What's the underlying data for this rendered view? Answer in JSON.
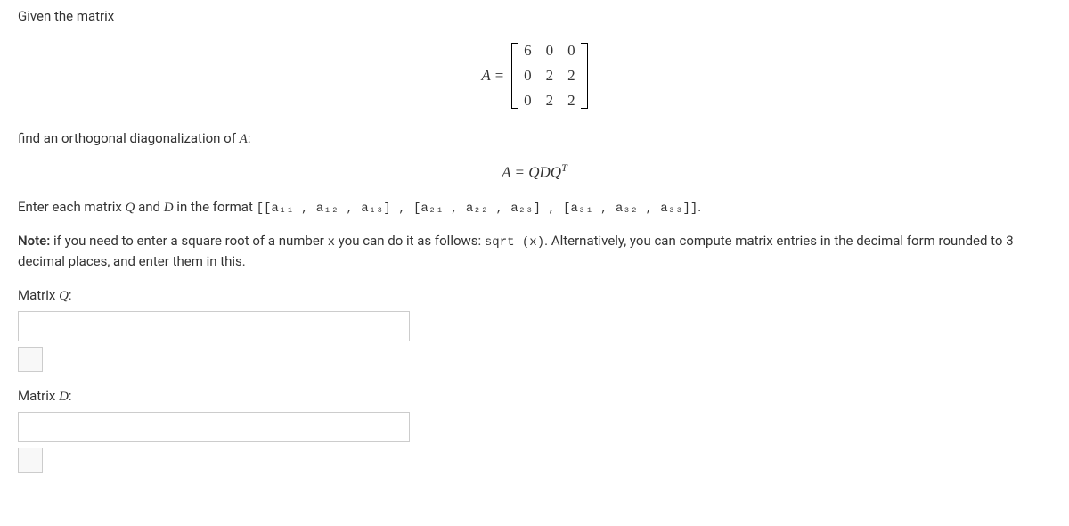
{
  "problem": {
    "intro": "Given the matrix",
    "matrix_label": "A =",
    "matrix": [
      [
        "6",
        "0",
        "0"
      ],
      [
        "0",
        "2",
        "2"
      ],
      [
        "0",
        "2",
        "2"
      ]
    ],
    "find_text_prefix": "find an orthogonal diagonalization of ",
    "find_text_symbol": "A",
    "find_text_suffix": ":",
    "diag_eq": "A = QDQ",
    "diag_eq_sup": "T",
    "enter_prefix": "Enter each matrix ",
    "enter_q": "Q",
    "enter_and": " and ",
    "enter_d": "D",
    "enter_mid": " in the format ",
    "format_string": "[[a₁₁ , a₁₂ , a₁₃] , [a₂₁ , a₂₂ , a₂₃] , [a₃₁ , a₃₂ , a₃₃]]",
    "enter_suffix": ".",
    "note_label": "Note:",
    "note_prefix": " if you need to enter a square root of a number ",
    "note_var": "x",
    "note_mid1": " you can do it as follows: ",
    "note_sqrt": "sqrt (x)",
    "note_mid2": ". Alternatively, you can compute matrix entries in the decimal form rounded to 3 decimal places, and enter them in this.",
    "matrix_q_label_prefix": "Matrix ",
    "matrix_q_label_symbol": "Q",
    "matrix_q_label_suffix": ":",
    "matrix_d_label_prefix": "Matrix ",
    "matrix_d_label_symbol": "D",
    "matrix_d_label_suffix": ":"
  }
}
